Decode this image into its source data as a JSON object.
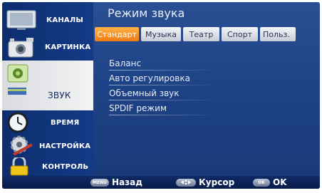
{
  "sidebar": {
    "items": [
      {
        "label": "КАНАЛЫ",
        "icon": "tv-icon"
      },
      {
        "label": "КАРТИНКА",
        "icon": "camera-icon"
      },
      {
        "label": "ЗВУК",
        "icon": "speaker-icon"
      },
      {
        "label": "ВРЕМЯ",
        "icon": "clock-icon"
      },
      {
        "label": "НАСТРОЙКА",
        "icon": "gear-icon"
      },
      {
        "label": "КОНТРОЛЬ",
        "icon": "lock-icon"
      }
    ],
    "active_index": 2
  },
  "main": {
    "title": "Режим звука",
    "tabs": [
      {
        "label": "Стандарт",
        "active": true
      },
      {
        "label": "Музыка",
        "active": false
      },
      {
        "label": "Театр",
        "active": false
      },
      {
        "label": "Спорт",
        "active": false
      },
      {
        "label": "Польз.",
        "active": false
      }
    ],
    "options": [
      "Баланс",
      "Авто регулировка",
      "Объемный звук",
      "SPDIF режим"
    ]
  },
  "footer": {
    "back": {
      "key": "MENU",
      "label": "Назад"
    },
    "cursor": {
      "key": "",
      "label": "Курсор"
    },
    "ok": {
      "key": "OK",
      "label": "OK"
    }
  },
  "colors": {
    "accent": "#f28c1e",
    "background": "#1e4286",
    "active_tab": "#f07a12"
  }
}
